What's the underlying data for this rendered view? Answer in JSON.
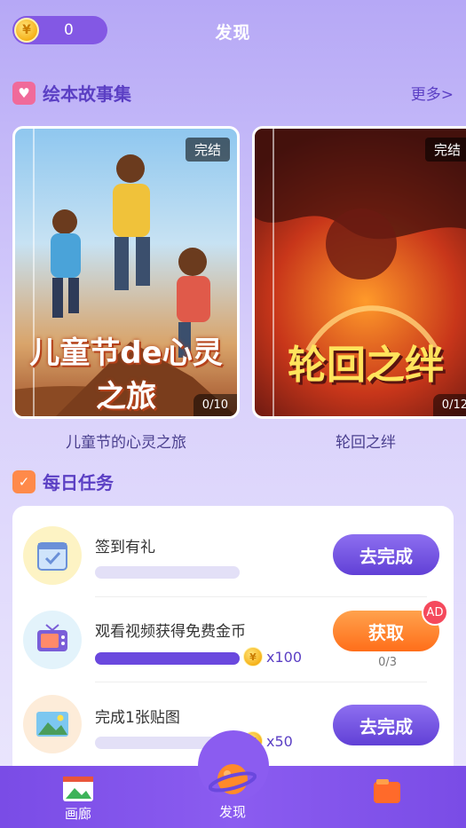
{
  "header": {
    "coin_count": "0",
    "title": "发现"
  },
  "picture_books": {
    "title": "绘本故事集",
    "more": "更多>",
    "items": [
      {
        "cover_text": "儿童节de心灵之旅",
        "badge": "完结",
        "progress": "0/10",
        "label": "儿童节的心灵之旅"
      },
      {
        "cover_text": "轮回之绊",
        "badge": "完结",
        "progress": "0/12",
        "label": "轮回之绊"
      }
    ]
  },
  "daily_tasks": {
    "title": "每日任务",
    "items": [
      {
        "title": "签到有礼",
        "button": "去完成",
        "progress_fraction": 0,
        "reward": ""
      },
      {
        "title": "观看视频获得免费金币",
        "button": "获取",
        "ad_badge": "AD",
        "progress_fraction": 1,
        "reward": "x100",
        "count": "0/3"
      },
      {
        "title": "完成1张贴图",
        "button": "去完成",
        "progress_fraction": 0,
        "reward": "x50"
      }
    ]
  },
  "bottom_nav": {
    "items": [
      {
        "label": "画廊"
      },
      {
        "label": "发现"
      },
      {
        "label": ""
      }
    ]
  },
  "colors": {
    "accent": "#6a48de",
    "claim_button": "#ff7a24",
    "ad_badge": "#f5495c"
  }
}
